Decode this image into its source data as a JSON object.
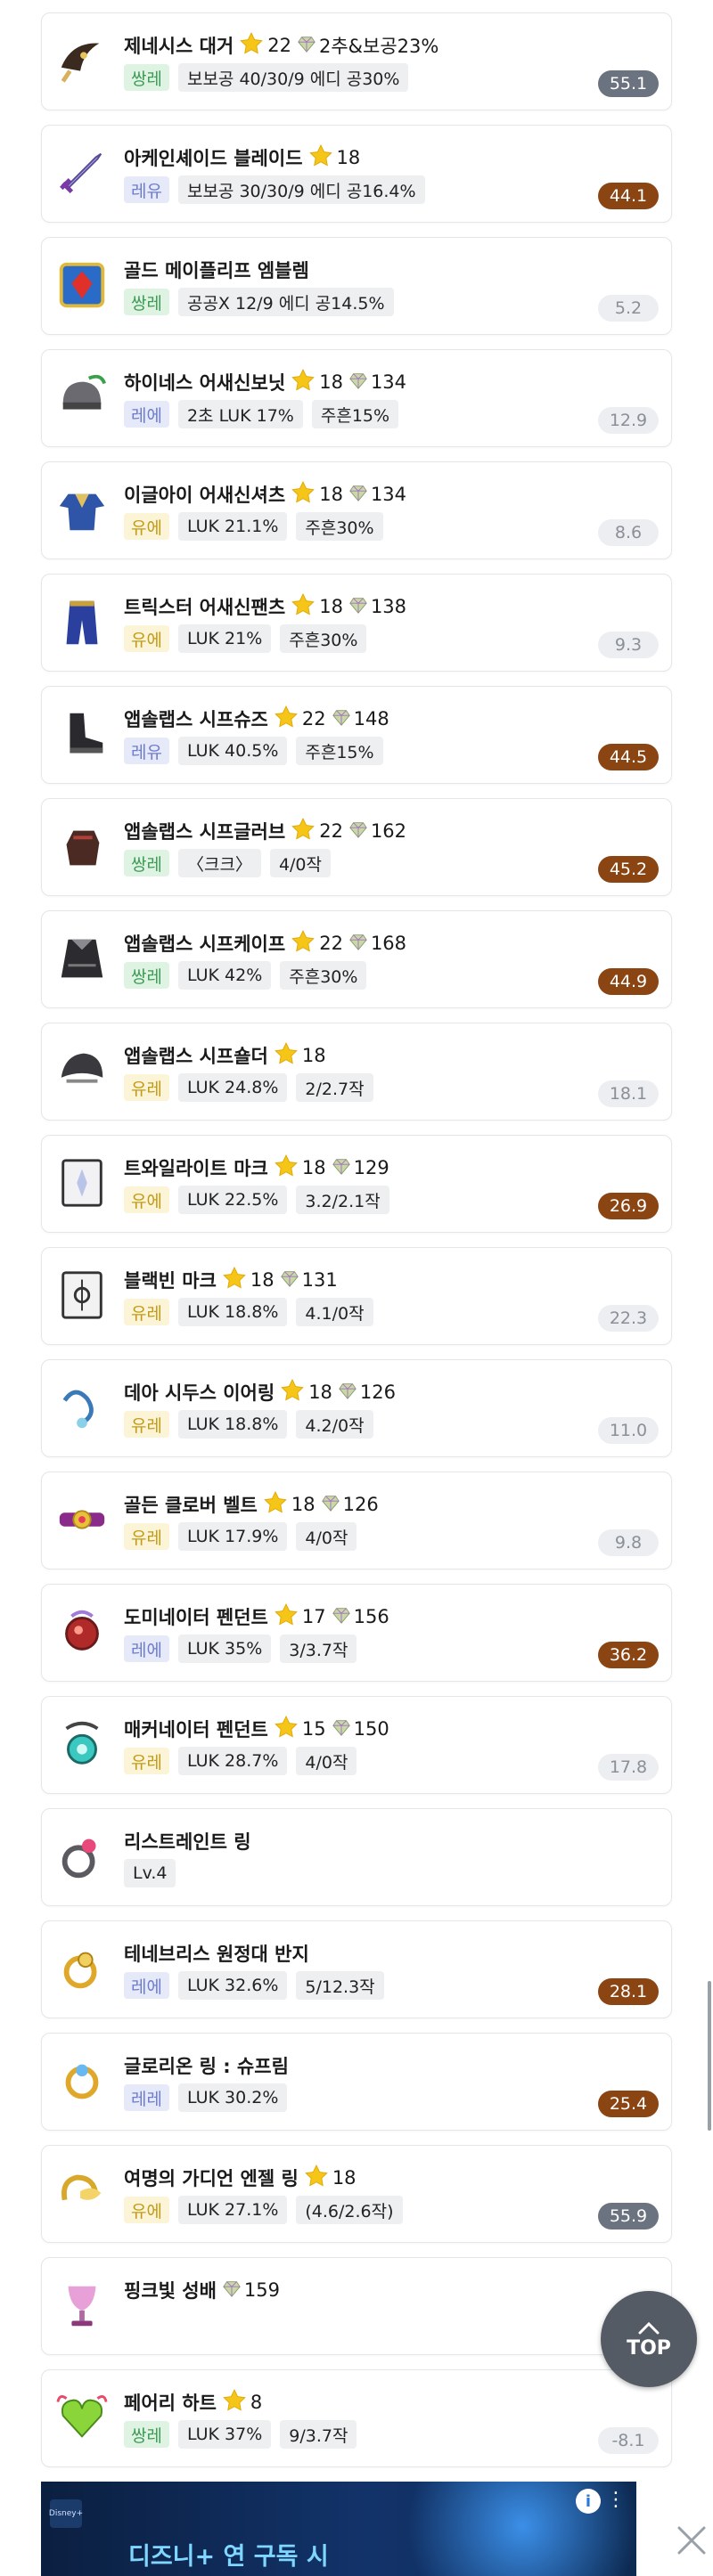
{
  "items": [
    {
      "name": "제네시스 대거",
      "star": "22",
      "gem": "",
      "extra": "2추&보공23%",
      "icon": "dagger-icon",
      "grade": "쌍레",
      "stats": [
        "보보공 40/30/9 에디 공30%"
      ],
      "score": "55.1",
      "level": "mid"
    },
    {
      "name": "아케인셰이드 블레이드",
      "star": "18",
      "gem": "",
      "extra": "",
      "icon": "blade-icon",
      "grade": "레유",
      "stats": [
        "보보공 30/30/9 에디 공16.4%"
      ],
      "score": "44.1",
      "level": "high"
    },
    {
      "name": "골드 메이플리프 엠블렘",
      "star": "",
      "gem": "",
      "extra": "",
      "icon": "emblem-icon",
      "grade": "쌍레",
      "stats": [
        "공공X 12/9 에디 공14.5%"
      ],
      "score": "5.2",
      "level": "low"
    },
    {
      "name": "하이네스 어새신보닛",
      "star": "18",
      "gem": "134",
      "extra": "",
      "icon": "helmet-icon",
      "grade": "레에",
      "stats": [
        "2초 LUK 17%",
        "주흔15%"
      ],
      "score": "12.9",
      "level": "low"
    },
    {
      "name": "이글아이 어새신셔츠",
      "star": "18",
      "gem": "134",
      "extra": "",
      "icon": "shirt-icon",
      "grade": "유에",
      "stats": [
        "LUK 21.1%",
        "주흔30%"
      ],
      "score": "8.6",
      "level": "low"
    },
    {
      "name": "트릭스터 어새신팬츠",
      "star": "18",
      "gem": "138",
      "extra": "",
      "icon": "pants-icon",
      "grade": "유에",
      "stats": [
        "LUK 21%",
        "주흔30%"
      ],
      "score": "9.3",
      "level": "low"
    },
    {
      "name": "앱솔랩스 시프슈즈",
      "star": "22",
      "gem": "148",
      "extra": "",
      "icon": "shoes-icon",
      "grade": "레유",
      "stats": [
        "LUK 40.5%",
        "주흔15%"
      ],
      "score": "44.5",
      "level": "high"
    },
    {
      "name": "앱솔랩스 시프글러브",
      "star": "22",
      "gem": "162",
      "extra": "",
      "icon": "glove-icon",
      "grade": "쌍레",
      "stats": [
        "〈크크〉",
        "4/0작"
      ],
      "score": "45.2",
      "level": "high"
    },
    {
      "name": "앱솔랩스 시프케이프",
      "star": "22",
      "gem": "168",
      "extra": "",
      "icon": "cape-icon",
      "grade": "쌍레",
      "stats": [
        "LUK 42%",
        "주흔30%"
      ],
      "score": "44.9",
      "level": "high"
    },
    {
      "name": "앱솔랩스 시프숄더",
      "star": "18",
      "gem": "",
      "extra": "",
      "icon": "shoulder-icon",
      "grade": "유레",
      "stats": [
        "LUK 24.8%",
        "2/2.7작"
      ],
      "score": "18.1",
      "level": "low"
    },
    {
      "name": "트와일라이트 마크",
      "star": "18",
      "gem": "129",
      "extra": "",
      "icon": "mark-icon",
      "grade": "유에",
      "stats": [
        "LUK 22.5%",
        "3.2/2.1작"
      ],
      "score": "26.9",
      "level": "high"
    },
    {
      "name": "블랙빈 마크",
      "star": "18",
      "gem": "131",
      "extra": "",
      "icon": "blackbean-mark-icon",
      "grade": "유레",
      "stats": [
        "LUK 18.8%",
        "4.1/0작"
      ],
      "score": "22.3",
      "level": "low"
    },
    {
      "name": "데아 시두스 이어링",
      "star": "18",
      "gem": "126",
      "extra": "",
      "icon": "earring-icon",
      "grade": "유레",
      "stats": [
        "LUK 18.8%",
        "4.2/0작"
      ],
      "score": "11.0",
      "level": "low"
    },
    {
      "name": "골든 클로버 벨트",
      "star": "18",
      "gem": "126",
      "extra": "",
      "icon": "belt-icon",
      "grade": "유레",
      "stats": [
        "LUK 17.9%",
        "4/0작"
      ],
      "score": "9.8",
      "level": "low"
    },
    {
      "name": "도미네이터 펜던트",
      "star": "17",
      "gem": "156",
      "extra": "",
      "icon": "dominator-pendant-icon",
      "grade": "레에",
      "stats": [
        "LUK 35%",
        "3/3.7작"
      ],
      "score": "36.2",
      "level": "high"
    },
    {
      "name": "매커네이터 펜던트",
      "star": "15",
      "gem": "150",
      "extra": "",
      "icon": "mechanator-pendant-icon",
      "grade": "유레",
      "stats": [
        "LUK 28.7%",
        "4/0작"
      ],
      "score": "17.8",
      "level": "low"
    },
    {
      "name": "리스트레인트 링",
      "star": "",
      "gem": "",
      "extra": "",
      "icon": "restraint-ring-icon",
      "grade": "",
      "stats": [
        "Lv.4"
      ],
      "score": "",
      "level": "low"
    },
    {
      "name": "테네브리스 원정대 반지",
      "star": "",
      "gem": "",
      "extra": "",
      "icon": "ring-icon",
      "grade": "레에",
      "stats": [
        "LUK 32.6%",
        "5/12.3작"
      ],
      "score": "28.1",
      "level": "high"
    },
    {
      "name": "글로리온 링 : 슈프림",
      "star": "",
      "gem": "",
      "extra": "",
      "icon": "glorion-ring-icon",
      "grade": "레레",
      "stats": [
        "LUK 30.2%"
      ],
      "score": "25.4",
      "level": "high"
    },
    {
      "name": "여명의 가디언 엔젤 링",
      "star": "18",
      "gem": "",
      "extra": "",
      "icon": "angel-ring-icon",
      "grade": "유에",
      "stats": [
        "LUK 27.1%",
        "(4.6/2.6작)"
      ],
      "score": "55.9",
      "level": "mid"
    },
    {
      "name": "핑크빛 성배",
      "star": "",
      "gem": "159",
      "extra": "",
      "icon": "pink-chalice-icon",
      "grade": "",
      "stats": [],
      "score": "",
      "level": "low"
    },
    {
      "name": "페어리 하트",
      "star": "8",
      "gem": "",
      "extra": "",
      "icon": "fairy-heart-icon",
      "grade": "쌍레",
      "stats": [
        "LUK 37%",
        "9/3.7작"
      ],
      "score": "-8.1",
      "level": "low"
    }
  ],
  "top_button": {
    "label": "TOP"
  },
  "ad": {
    "headline": "디즈니+ 연 구독 시",
    "brand": "Disney+",
    "info": "i"
  },
  "colors": {
    "high": "#8b4513",
    "mid": "#6b7280",
    "low": "#eceef1"
  }
}
